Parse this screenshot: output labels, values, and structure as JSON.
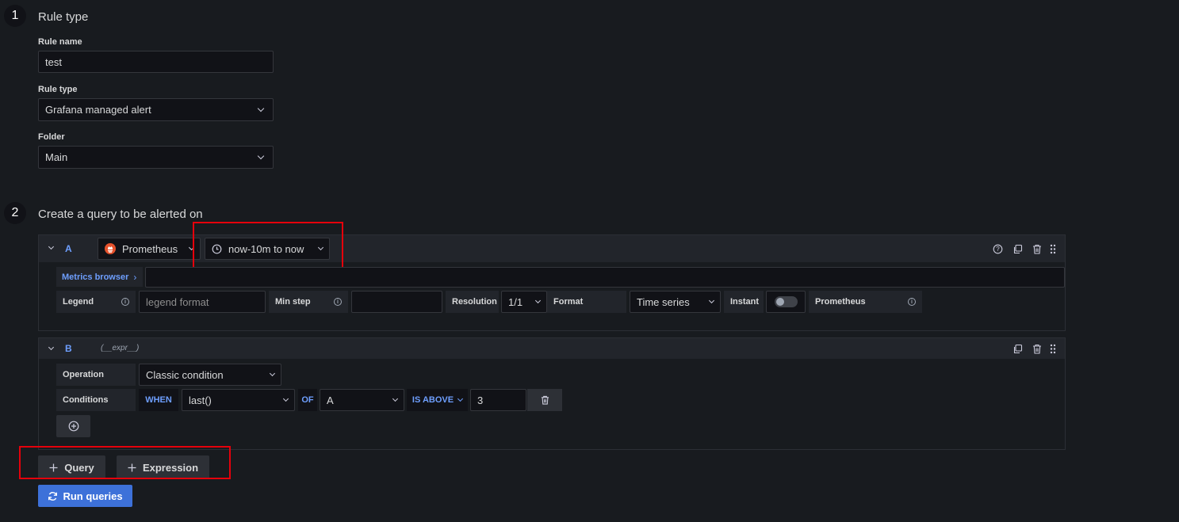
{
  "step1": {
    "number": "1",
    "title": "Rule type",
    "rule_name_label": "Rule name",
    "rule_name_value": "test",
    "rule_type_label": "Rule type",
    "rule_type_value": "Grafana managed alert",
    "folder_label": "Folder",
    "folder_value": "Main"
  },
  "step2": {
    "number": "2",
    "title": "Create a query to be alerted on"
  },
  "query_a": {
    "ref": "A",
    "datasource": "Prometheus",
    "time_range": "now-10m to now",
    "metrics_browser": "Metrics browser",
    "metrics_browser_chevron": "›",
    "query_value": "",
    "legend_label": "Legend",
    "legend_placeholder": "legend format",
    "min_step_label": "Min step",
    "min_step_value": "",
    "resolution_label": "Resolution",
    "resolution_value": "1/1",
    "format_label": "Format",
    "format_value": "Time series",
    "instant_label": "Instant",
    "instant_on": false,
    "datasource_label": "Prometheus"
  },
  "query_b": {
    "ref": "B",
    "subtitle": "(__expr__)",
    "operation_label": "Operation",
    "operation_value": "Classic condition",
    "conditions_label": "Conditions",
    "when": "WHEN",
    "reducer": "last()",
    "of": "OF",
    "of_query": "A",
    "evaluator": "IS ABOVE",
    "threshold": "3"
  },
  "actions": {
    "add_query": "Query",
    "add_expression": "Expression",
    "run_queries": "Run queries"
  },
  "colors": {
    "background": "#181b1f",
    "accent_blue": "#6e9fff",
    "primary_button": "#3d71d9",
    "highlight_red": "#e5000b",
    "prometheus_orange": "#e6522c"
  },
  "icons": {
    "collapse": "chevron-down-icon",
    "prometheus": "prometheus-logo",
    "clock": "clock-icon",
    "help": "question-circle-icon",
    "duplicate": "copy-icon",
    "delete": "trash-icon",
    "drag": "drag-handle-icon",
    "add": "plus-icon",
    "run": "sync-icon"
  }
}
